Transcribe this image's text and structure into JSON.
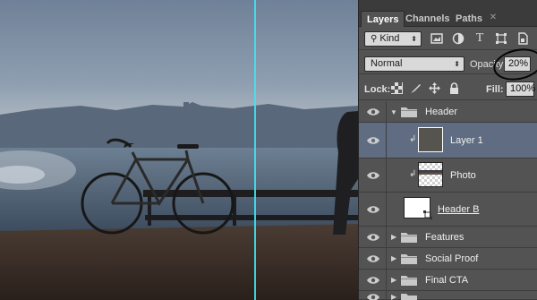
{
  "canvas": {
    "image": "bicycle-by-the-sea-photo",
    "guide_color": "#3fe3f2"
  },
  "panel": {
    "tabs": [
      {
        "label": "Layers",
        "active": true
      },
      {
        "label": "Channels",
        "active": false
      },
      {
        "label": "Paths",
        "active": false
      }
    ],
    "filter": {
      "kind_label": "Kind",
      "icons": [
        "image-filter-icon",
        "adjustment-filter-icon",
        "type-filter-icon",
        "shape-filter-icon",
        "smart-object-filter-icon"
      ]
    },
    "blend_mode": "Normal",
    "opacity_label": "Opacity:",
    "opacity_value": "20%",
    "lock_label": "Lock:",
    "lock_icons": [
      "lock-transparency-icon",
      "lock-image-icon",
      "lock-position-icon",
      "lock-all-icon"
    ],
    "fill_label": "Fill:",
    "fill_value": "100%"
  },
  "layers": [
    {
      "name": "Header",
      "type": "group",
      "expanded": true
    },
    {
      "name": "Layer 1",
      "type": "layer",
      "selected": true,
      "clipped": true
    },
    {
      "name": "Photo",
      "type": "layer",
      "clipped": true
    },
    {
      "name": "Header B",
      "type": "shape"
    },
    {
      "name": "Features",
      "type": "group",
      "expanded": false
    },
    {
      "name": "Social Proof",
      "type": "group",
      "expanded": false
    },
    {
      "name": "Final CTA",
      "type": "group",
      "expanded": false
    }
  ],
  "colors": {
    "panel_bg": "#535353",
    "selected_row": "#5f6c82",
    "guide": "#3fe3f2"
  }
}
